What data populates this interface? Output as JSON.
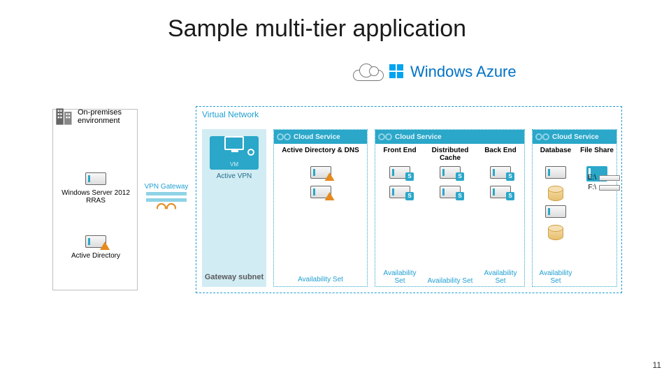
{
  "title": "Sample multi-tier application",
  "page_number": "11",
  "onprem": {
    "header_l1": "On-premises",
    "header_l2": "environment",
    "rras": "Windows Server 2012 RRAS",
    "ad": "Active Directory"
  },
  "vpn": {
    "label": "VPN Gateway"
  },
  "azure": {
    "brand": "Windows Azure",
    "vnet_label": "Virtual Network",
    "gateway": {
      "vm_label": "Active VPN",
      "subnet_label": "Gateway subnet"
    },
    "cloud_service_label": "Cloud Service",
    "availability_set_label": "Availability Set",
    "tiers": {
      "addns": "Active Directory & DNS",
      "frontend": "Front End",
      "cache": "Distributed Cache",
      "backend": "Back End",
      "database": "Database",
      "fileshare": "File Share"
    },
    "drives": {
      "e": "E:\\",
      "f": "F:\\"
    }
  }
}
